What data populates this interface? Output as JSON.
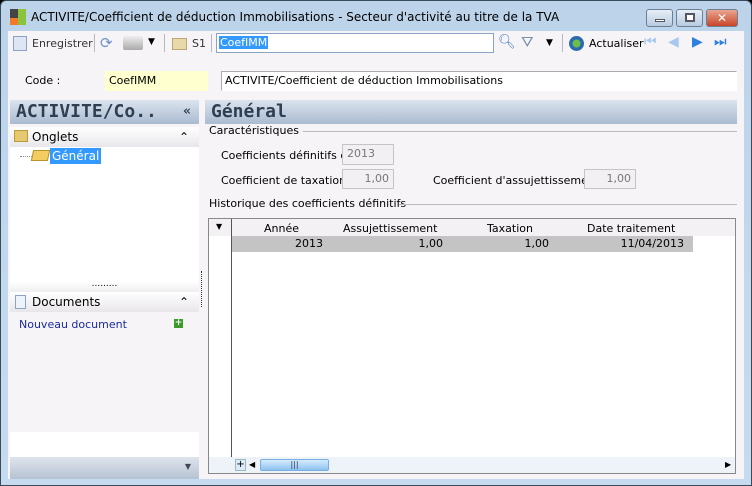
{
  "window": {
    "title": "ACTIVITE/Coefficient de déduction Immobilisations -  Secteur d'activité au titre de la TVA"
  },
  "toolbar": {
    "save": "Enregistrer",
    "s1": "S1",
    "search_value": "CoefIMM",
    "refresh": "Actualiser"
  },
  "code": {
    "label": "Code :",
    "value": "CoefIMM",
    "description": "ACTIVITE/Coefficient de déduction Immobilisations"
  },
  "left": {
    "header": "ACTIVITE/Co..",
    "collapse": "«",
    "tabs_section": "Onglets",
    "tab_general": "Général",
    "documents_section": "Documents",
    "new_document": "Nouveau document"
  },
  "main": {
    "header": "Général",
    "caracteristiques": "Caractéristiques",
    "coef_def_label": "Coefficients définitifs de :",
    "coef_def_value": "2013",
    "taxation_label": "Coefficient de taxation :",
    "taxation_value": "1,00",
    "assuj_label": "Coefficient d'assujettissement :",
    "assuj_value": "1,00",
    "historique": "Historique des coefficients définitifs",
    "columns": [
      "Année",
      "Assujettissement",
      "Taxation",
      "Date traitement"
    ],
    "rows": [
      [
        "2013",
        "1,00",
        "1,00",
        "11/04/2013"
      ]
    ]
  }
}
